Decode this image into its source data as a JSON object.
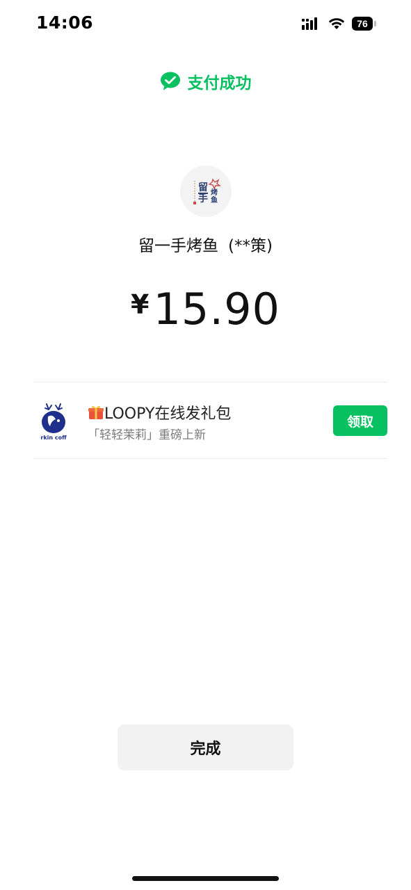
{
  "status_bar": {
    "time": "14:06",
    "battery_level": "76",
    "icons": [
      "cellular-signal-icon",
      "wifi-icon",
      "battery-icon"
    ]
  },
  "header": {
    "title": "支付成功",
    "icon": "wechat-pay-check-icon",
    "accent_color": "#07c160"
  },
  "merchant": {
    "name": "留一手烤鱼",
    "payee_masked": "(**策)",
    "logo_text": "留一手 烤鱼"
  },
  "payment": {
    "currency_symbol": "¥",
    "amount": "15.90"
  },
  "promo": {
    "icon": "gift-icon",
    "title": "LOOPY在线发礼包",
    "subtitle": "「轻轻茉莉」重磅上新",
    "logo_text": "rkin coff",
    "claim_label": "领取"
  },
  "actions": {
    "done_label": "完成"
  }
}
